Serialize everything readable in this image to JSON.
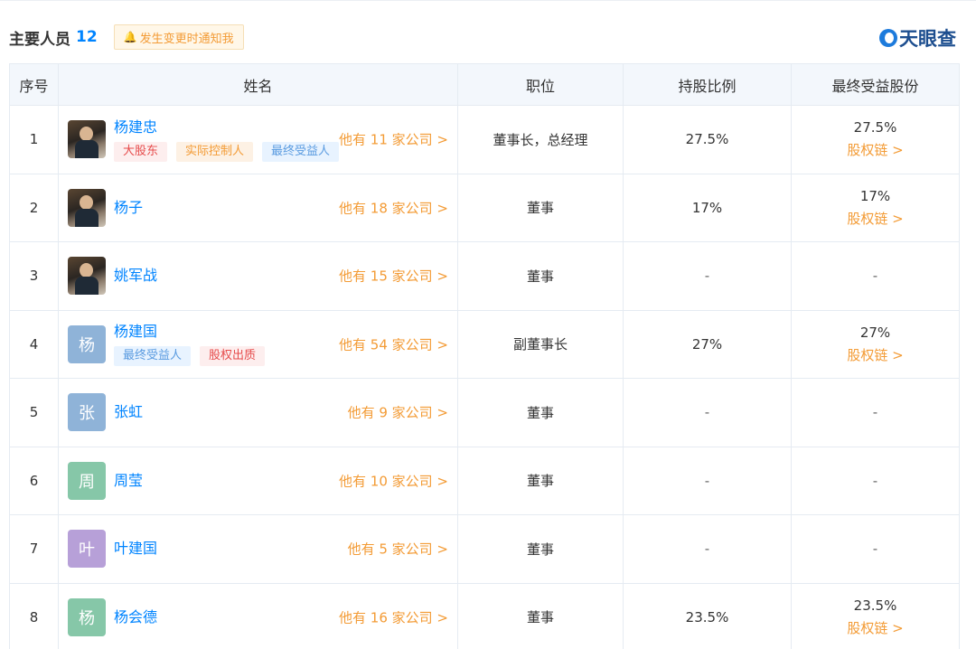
{
  "header": {
    "title": "主要人员",
    "count": "12",
    "notify_label": "发生变更时通知我",
    "logo_text": "天眼查"
  },
  "columns": [
    "序号",
    "姓名",
    "职位",
    "持股比例",
    "最终受益股份"
  ],
  "rows": [
    {
      "index": "1",
      "name": "杨建忠",
      "avatar_type": "photo",
      "avatar_char": "",
      "avatar_color": "",
      "tags": [
        {
          "text": "大股东",
          "style": "red"
        },
        {
          "text": "实际控制人",
          "style": "orange"
        },
        {
          "text": "最终受益人",
          "style": "blue"
        }
      ],
      "companies": "他有 11 家公司 >",
      "position": "董事长，总经理",
      "share": "27.5%",
      "benefit": "27.5%",
      "chain": "股权链 >"
    },
    {
      "index": "2",
      "name": "杨子",
      "avatar_type": "photo",
      "avatar_char": "",
      "avatar_color": "",
      "tags": [],
      "companies": "他有 18 家公司 >",
      "position": "董事",
      "share": "17%",
      "benefit": "17%",
      "chain": "股权链 >"
    },
    {
      "index": "3",
      "name": "姚军战",
      "avatar_type": "photo",
      "avatar_char": "",
      "avatar_color": "",
      "tags": [],
      "companies": "他有 15 家公司 >",
      "position": "董事",
      "share": "-",
      "benefit": "-",
      "chain": ""
    },
    {
      "index": "4",
      "name": "杨建国",
      "avatar_type": "char",
      "avatar_char": "杨",
      "avatar_color": "#8fb3d8",
      "tags": [
        {
          "text": "最终受益人",
          "style": "blue"
        },
        {
          "text": "股权出质",
          "style": "red"
        }
      ],
      "companies": "他有 54 家公司 >",
      "position": "副董事长",
      "share": "27%",
      "benefit": "27%",
      "chain": "股权链 >"
    },
    {
      "index": "5",
      "name": "张虹",
      "avatar_type": "char",
      "avatar_char": "张",
      "avatar_color": "#8fb3d8",
      "tags": [],
      "companies": "他有 9 家公司 >",
      "position": "董事",
      "share": "-",
      "benefit": "-",
      "chain": ""
    },
    {
      "index": "6",
      "name": "周莹",
      "avatar_type": "char",
      "avatar_char": "周",
      "avatar_color": "#86c7a8",
      "tags": [],
      "companies": "他有 10 家公司 >",
      "position": "董事",
      "share": "-",
      "benefit": "-",
      "chain": ""
    },
    {
      "index": "7",
      "name": "叶建国",
      "avatar_type": "char",
      "avatar_char": "叶",
      "avatar_color": "#b7a0d8",
      "tags": [],
      "companies": "他有 5 家公司 >",
      "position": "董事",
      "share": "-",
      "benefit": "-",
      "chain": ""
    },
    {
      "index": "8",
      "name": "杨会德",
      "avatar_type": "char",
      "avatar_char": "杨",
      "avatar_color": "#86c7a8",
      "tags": [],
      "companies": "他有 16 家公司 >",
      "position": "董事",
      "share": "23.5%",
      "benefit": "23.5%",
      "chain": "股权链 >"
    }
  ]
}
